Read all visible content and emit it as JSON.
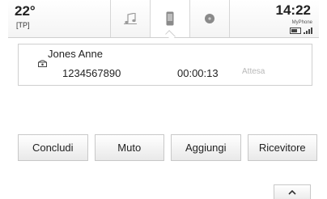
{
  "status_bar": {
    "temperature": "22°",
    "source": "[TP]",
    "time": "14:22",
    "phone_name": "MyPhone"
  },
  "tabs": [
    {
      "icon": "music-note-icon"
    },
    {
      "icon": "phone-icon",
      "active": true
    },
    {
      "icon": "circle-icon"
    }
  ],
  "call": {
    "contact_name": "Jones Anne",
    "number": "1234567890",
    "duration": "00:00:13",
    "status": "Attesa"
  },
  "buttons": {
    "end": "Concludi",
    "mute": "Muto",
    "add": "Aggiungi",
    "handset": "Ricevitore"
  },
  "more_icon": "chevron-up-icon"
}
